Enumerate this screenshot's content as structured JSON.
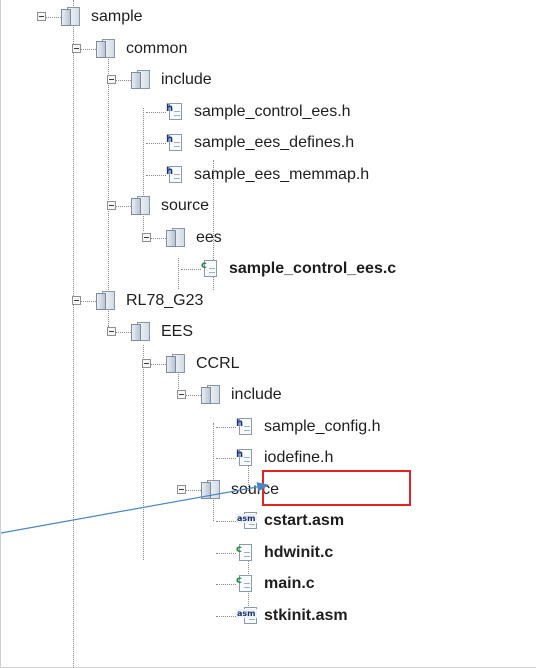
{
  "tree": {
    "items": [
      {
        "label": "sample",
        "type": "folder",
        "bold": false
      },
      {
        "label": "common",
        "type": "folder",
        "bold": false
      },
      {
        "label": "include",
        "type": "folder",
        "bold": false
      },
      {
        "label": "sample_control_ees.h",
        "type": "h-file",
        "bold": false
      },
      {
        "label": "sample_ees_defines.h",
        "type": "h-file",
        "bold": false
      },
      {
        "label": "sample_ees_memmap.h",
        "type": "h-file",
        "bold": false
      },
      {
        "label": "source",
        "type": "folder",
        "bold": false
      },
      {
        "label": "ees",
        "type": "folder",
        "bold": false
      },
      {
        "label": "sample_control_ees.c",
        "type": "c-file",
        "bold": true
      },
      {
        "label": "RL78_G23",
        "type": "folder",
        "bold": false
      },
      {
        "label": "EES",
        "type": "folder",
        "bold": false
      },
      {
        "label": "CCRL",
        "type": "folder",
        "bold": false
      },
      {
        "label": "include",
        "type": "folder",
        "bold": false
      },
      {
        "label": "sample_config.h",
        "type": "h-file",
        "bold": false
      },
      {
        "label": "iodefine.h",
        "type": "h-file",
        "bold": false,
        "highlighted": true
      },
      {
        "label": "source",
        "type": "folder",
        "bold": false
      },
      {
        "label": "cstart.asm",
        "type": "asm-file",
        "bold": true
      },
      {
        "label": "hdwinit.c",
        "type": "c-file",
        "bold": true
      },
      {
        "label": "main.c",
        "type": "c-file",
        "bold": true
      },
      {
        "label": "stkinit.asm",
        "type": "asm-file",
        "bold": true
      }
    ]
  },
  "icons": {
    "folder": "folder-icon",
    "h_file": "header-file-icon",
    "c_file": "c-source-file-icon",
    "asm_file": "asm-source-file-icon",
    "h_badge": "h",
    "c_badge": "c",
    "asm_badge": "asm"
  },
  "annotation": {
    "highlight_color": "#e32222",
    "arrow_color": "#4a86c5"
  }
}
